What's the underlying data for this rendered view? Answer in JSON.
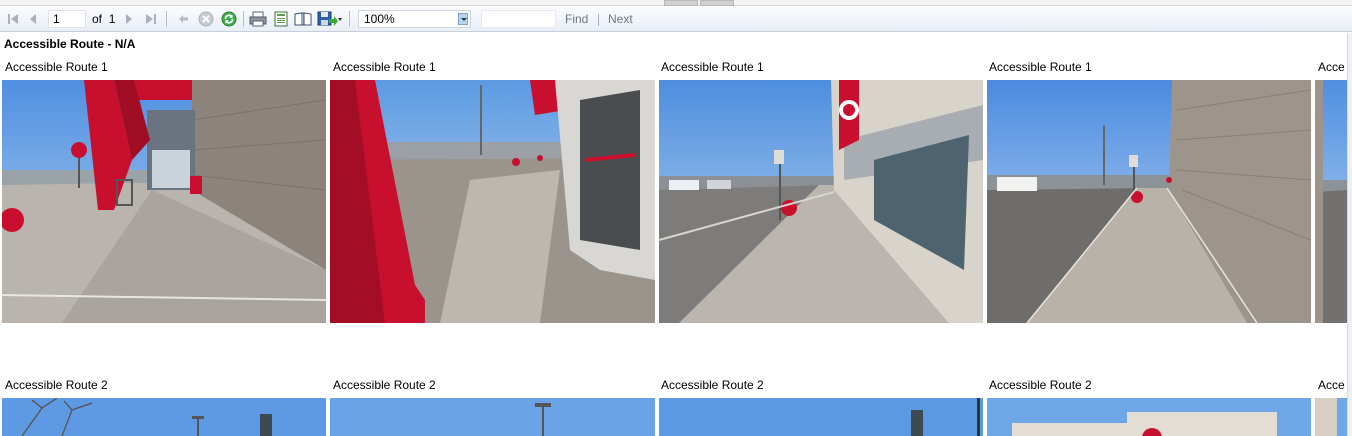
{
  "toolbar": {
    "page_current": "1",
    "page_of_label": "of",
    "page_total": "1",
    "zoom_value": "100%",
    "find_value": "",
    "find_label": "Find",
    "next_label": "Next"
  },
  "report": {
    "title": "Accessible Route - N/A",
    "row1_caption": "Accessible Route 1",
    "row2_caption": "Accessible Route 2",
    "partial_caption": "Acce"
  },
  "colors": {
    "target_red": "#c8102e",
    "sky_blue": "#5f9ee0",
    "concrete": "#b8b3ad",
    "brick": "#8b837c"
  }
}
